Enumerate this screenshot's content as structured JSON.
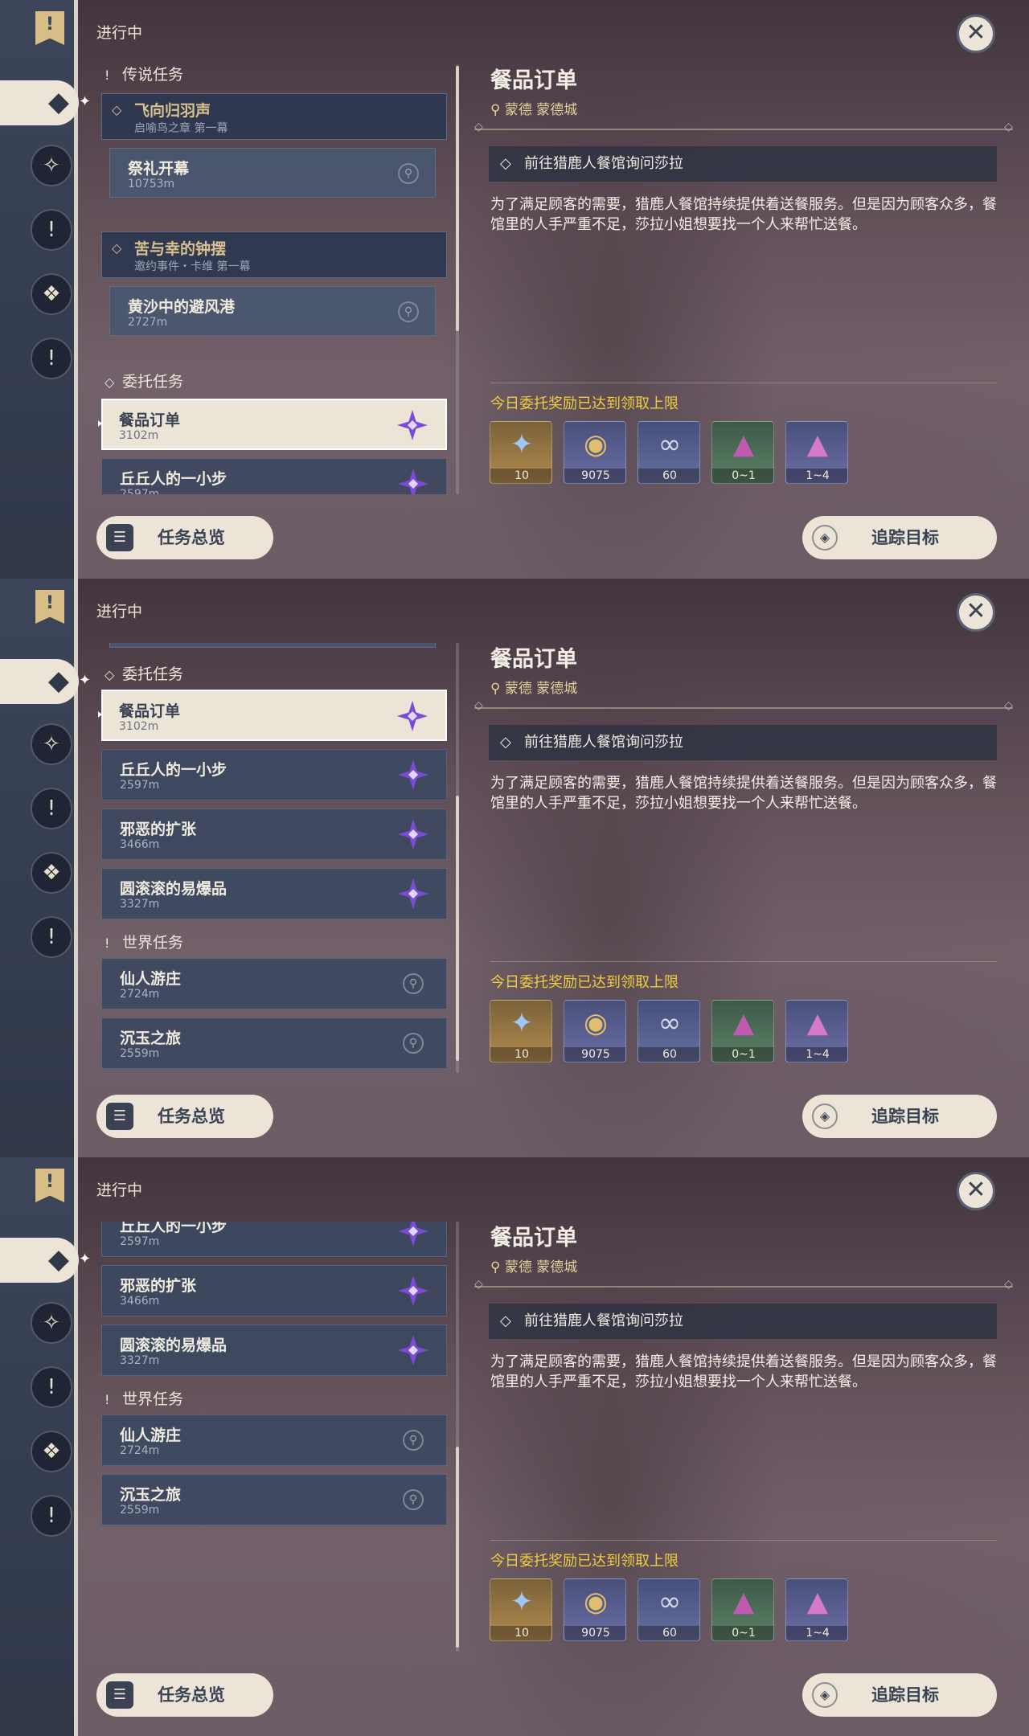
{
  "header": {
    "in_progress": "进行中"
  },
  "icons": {
    "close": "✕",
    "flag": "!",
    "overview": "☰",
    "track": "◈",
    "pin": "⚲",
    "diamond": "◇",
    "rail": [
      "◆",
      "✧",
      "!",
      "❖",
      "!"
    ]
  },
  "sections": {
    "legend": "传说任务",
    "commission": "委托任务",
    "world": "世界任务"
  },
  "quests": {
    "legend1": {
      "title": "飞向归羽声",
      "sub": "启喻鸟之章 第一幕"
    },
    "legend1_step": {
      "title": "祭礼开幕",
      "dist": "10753m"
    },
    "legend2": {
      "title": "苦与幸的钟摆",
      "sub": "邀约事件・卡维 第一幕"
    },
    "legend2_step": {
      "title": "黄沙中的避风港",
      "dist": "2727m"
    },
    "c1": {
      "title": "餐品订单",
      "dist": "3102m"
    },
    "c2": {
      "title": "丘丘人的一小步",
      "dist": "2597m"
    },
    "c3": {
      "title": "邪恶的扩张",
      "dist": "3466m"
    },
    "c4": {
      "title": "圆滚滚的易爆品",
      "dist": "3327m"
    },
    "w1": {
      "title": "仙人游庄",
      "dist": "2724m"
    },
    "w2": {
      "title": "沉玉之旅",
      "dist": "2559m"
    }
  },
  "detail": {
    "title": "餐品订单",
    "location": "蒙德 蒙德城",
    "objective": "前往猎鹿人餐馆询问莎拉",
    "description": "为了满足顾客的需要，猎鹿人餐馆持续提供着送餐服务。但是因为顾客众多，餐馆里的人手严重不足，莎拉小姐想要找一个人来帮忙送餐。",
    "reward_note": "今日委托奖励已达到领取上限",
    "rewards": [
      {
        "icon": "✦",
        "qty": "10"
      },
      {
        "icon": "◉",
        "qty": "9075"
      },
      {
        "icon": "∞",
        "qty": "60"
      },
      {
        "icon": "▲",
        "qty": "0~1"
      },
      {
        "icon": "▲",
        "qty": "1~4"
      }
    ]
  },
  "buttons": {
    "overview": "任务总览",
    "track": "追踪目标"
  },
  "colors": {
    "accent_yellow": "#f2cc3c",
    "legend_gold": "#d9c28f",
    "selected_bg": "#ece5d7",
    "commission_star": "#7b4bd6"
  }
}
